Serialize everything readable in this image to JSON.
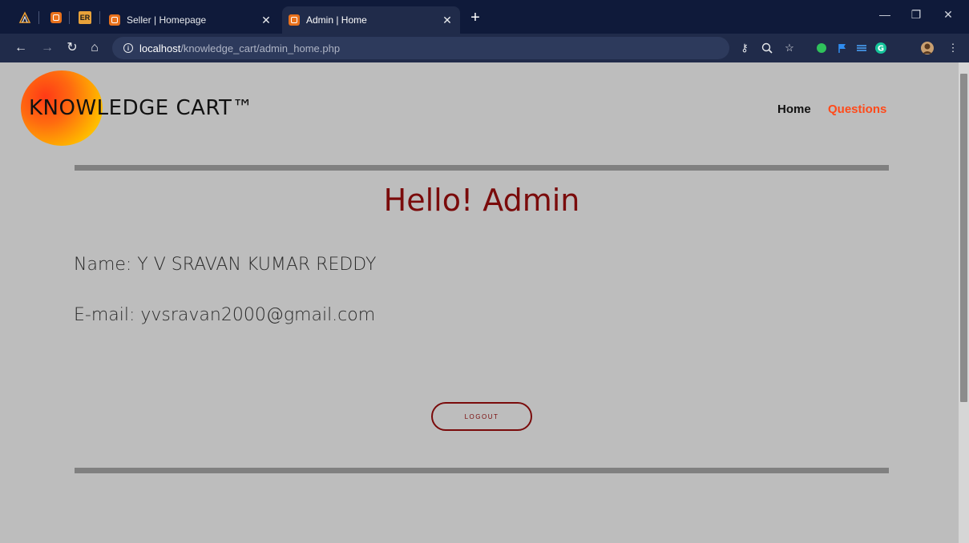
{
  "browser": {
    "tabs": [
      {
        "title": "Seller | Homepage",
        "active": false
      },
      {
        "title": "Admin | Home",
        "active": true
      }
    ],
    "pinned": [
      "hp-icon",
      "xampp-icon",
      "er-icon"
    ],
    "pinned_er_label": "ER",
    "new_tab_label": "+",
    "url_host": "localhost",
    "url_path": "/knowledge_cart/admin_home.php"
  },
  "site": {
    "logo_text": "KNOWLEDGE CART™",
    "nav": {
      "home": "Home",
      "questions": "Questions"
    }
  },
  "main": {
    "greeting": "Hello! Admin",
    "name_line": "Name: Y V SRAVAN KUMAR REDDY",
    "email_line": "E-mail: yvsravan2000@gmail.com",
    "logout_label": "LOGOUT"
  },
  "colors": {
    "page_bg": "#bdbdbd",
    "accent_red": "#7a0b0b",
    "nav_active": "#ff4a1a",
    "tabstrip": "#0f1a3a"
  }
}
